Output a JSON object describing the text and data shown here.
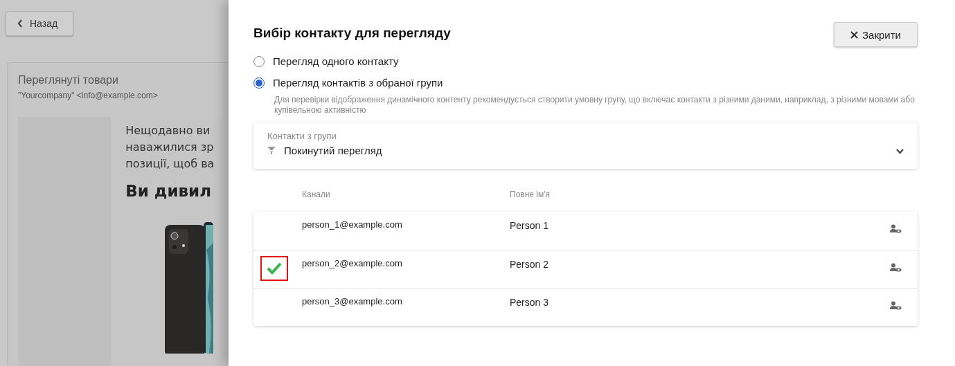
{
  "background": {
    "back_button": "Назад",
    "card_title": "Переглянуті товари",
    "sender": "\"Yourcompany\" <info@example.com>",
    "email_lines": [
      "Нещодавно ви",
      "наважилися зр",
      "позиції, щоб ва"
    ],
    "email_heading": "Ви дивил"
  },
  "modal": {
    "title": "Вибір контакту для перегляду",
    "close_button": "Закрити",
    "radios": [
      {
        "label": "Перегляд одного контакту",
        "selected": false
      },
      {
        "label": "Перегляд контактів з обраної групи",
        "selected": true
      }
    ],
    "hint": "Для перевірки відображення динамічного контенту рекомендується створити умовну групу, що включає контакти з різними даними, наприклад, з різними мовами або купівельною активністю",
    "group_select": {
      "label": "Контакти з групи",
      "value": "Покинутий перегляд"
    },
    "table": {
      "columns": [
        "Канали",
        "Повне ім'я"
      ],
      "rows": [
        {
          "email": "person_1@example.com",
          "name": "Person 1",
          "selected": false
        },
        {
          "email": "person_2@example.com",
          "name": "Person 2",
          "selected": true
        },
        {
          "email": "person_3@example.com",
          "name": "Person 3",
          "selected": false
        }
      ]
    }
  }
}
